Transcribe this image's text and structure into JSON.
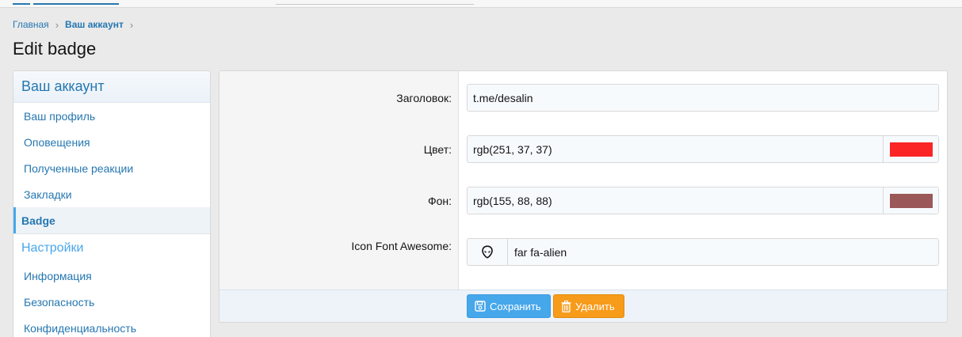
{
  "breadcrumb": [
    {
      "label": "Главная"
    },
    {
      "label": "Ваш аккаунт"
    }
  ],
  "page_title": "Edit badge",
  "sidebar": {
    "heading": "Ваш аккаунт",
    "items": [
      {
        "label": "Ваш профиль"
      },
      {
        "label": "Оповещения"
      },
      {
        "label": "Полученные реакции"
      },
      {
        "label": "Закладки"
      },
      {
        "label": "Badge",
        "active": true
      }
    ],
    "section2_heading": "Настройки",
    "items2": [
      {
        "label": "Информация"
      },
      {
        "label": "Безопасность"
      },
      {
        "label": "Конфиденциальность"
      }
    ]
  },
  "form": {
    "title_label": "Заголовок:",
    "title_value": "t.me/desalin",
    "color_label": "Цвет:",
    "color_value": "rgb(251, 37, 37)",
    "color_swatch": "#fb2525",
    "bg_label": "Фон:",
    "bg_value": "rgb(155, 88, 88)",
    "bg_swatch": "#9b5858",
    "icon_label": "Icon Font Awesome:",
    "icon_name": "alien-icon",
    "icon_value": "far fa-alien"
  },
  "buttons": {
    "save_label": "Сохранить",
    "delete_label": "Удалить",
    "save_color": "#47a7eb",
    "delete_color": "#f79b1b"
  }
}
